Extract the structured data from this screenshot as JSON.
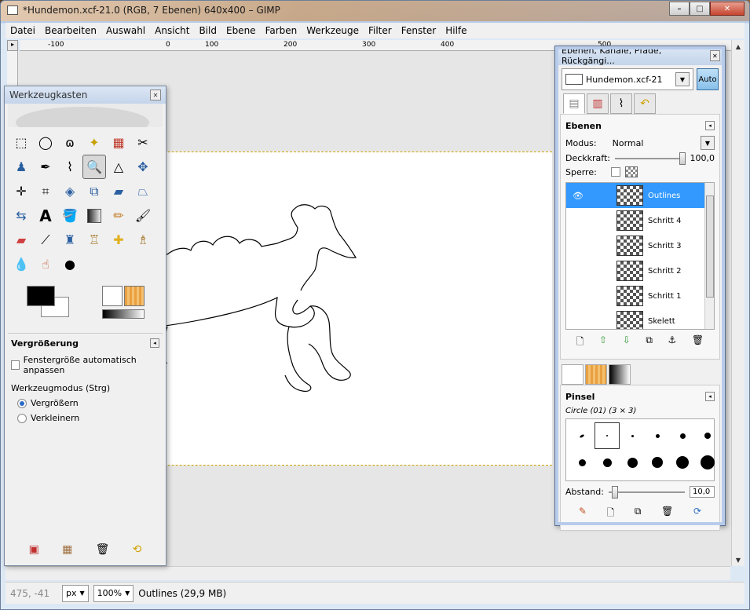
{
  "window": {
    "title": "*Hundemon.xcf-21.0 (RGB, 7 Ebenen) 640x400 – GIMP",
    "controls": [
      "–",
      "□",
      "✕"
    ]
  },
  "menu": [
    "Datei",
    "Bearbeiten",
    "Auswahl",
    "Ansicht",
    "Bild",
    "Ebene",
    "Farben",
    "Werkzeuge",
    "Filter",
    "Fenster",
    "Hilfe"
  ],
  "ruler": {
    "ticks": [
      {
        "label": "-100"
      },
      {
        "label": "0"
      },
      {
        "label": "100"
      },
      {
        "label": "200"
      },
      {
        "label": "300"
      },
      {
        "label": "400"
      },
      {
        "label": "500"
      }
    ]
  },
  "status": {
    "coords": "475, -41",
    "unit": "px",
    "zoom": "100%",
    "text": "Outlines (29,9 MB)"
  },
  "toolbox": {
    "title": "Werkzeugkasten",
    "tools": [
      "rect-select",
      "ellipse-select",
      "lasso",
      "fuzzy-select",
      "color-select",
      "scissors",
      "foreground-select",
      "paths",
      "color-picker",
      "zoom",
      "measure",
      "move",
      "align",
      "crop",
      "rotate",
      "scale",
      "shear",
      "perspective",
      "flip",
      "text",
      "bucket-fill",
      "blend",
      "pencil",
      "paintbrush",
      "eraser",
      "airbrush",
      "ink",
      "clone",
      "heal",
      "perspective-clone",
      "blur",
      "smudge",
      "dodge-burn"
    ],
    "options": {
      "heading": "Vergrößerung",
      "checkbox_label": "Fenstergröße automatisch anpassen",
      "mode_label": "Werkzeugmodus (Strg)",
      "radio_in": "Vergrößern",
      "radio_out": "Verkleinern"
    }
  },
  "dock": {
    "title": "Ebenen, Kanäle, Pfade, Rückgängi...",
    "image_name": "Hundemon.xcf-21",
    "auto": "Auto",
    "layers_heading": "Ebenen",
    "mode_label": "Modus:",
    "mode_value": "Normal",
    "opacity_label": "Deckkraft:",
    "opacity_value": "100,0",
    "lock_label": "Sperre:",
    "layers": [
      {
        "name": "Outlines",
        "visible": true,
        "selected": true
      },
      {
        "name": "Schritt 4",
        "visible": false,
        "selected": false
      },
      {
        "name": "Schritt 3",
        "visible": false,
        "selected": false
      },
      {
        "name": "Schritt 2",
        "visible": false,
        "selected": false
      },
      {
        "name": "Schritt 1",
        "visible": false,
        "selected": false
      },
      {
        "name": "Skelett",
        "visible": false,
        "selected": false
      }
    ],
    "brush_heading": "Pinsel",
    "brush_name": "Circle (01) (3 × 3)",
    "spacing_label": "Abstand:",
    "spacing_value": "10,0"
  }
}
